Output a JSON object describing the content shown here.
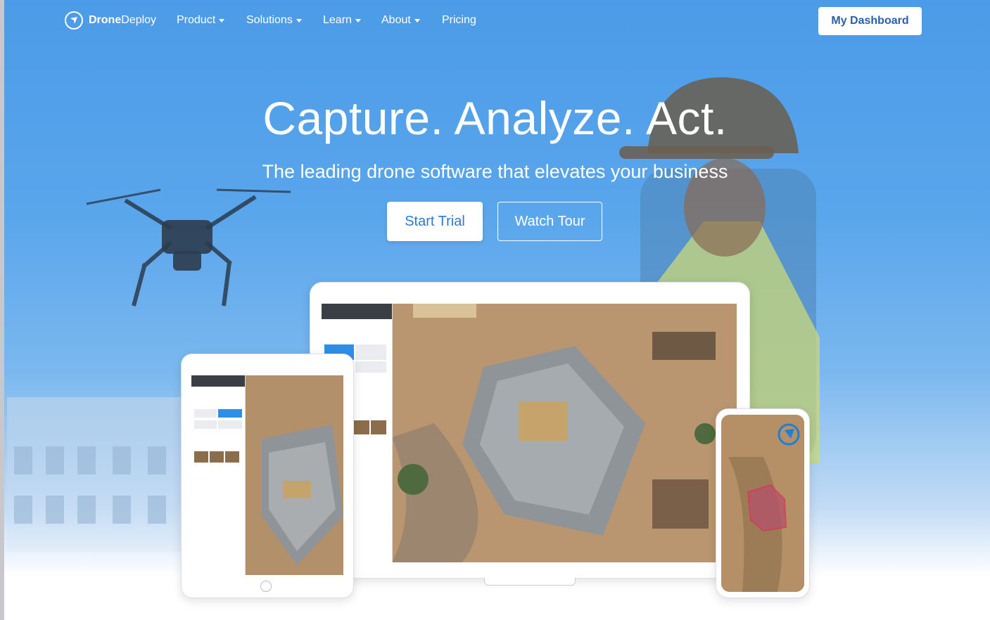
{
  "nav": {
    "brand_bold": "Drone",
    "brand_light": "Deploy",
    "items": [
      {
        "label": "Product",
        "dropdown": true
      },
      {
        "label": "Solutions",
        "dropdown": true
      },
      {
        "label": "Learn",
        "dropdown": true
      },
      {
        "label": "About",
        "dropdown": true
      },
      {
        "label": "Pricing",
        "dropdown": false
      }
    ],
    "dashboard_label": "My Dashboard"
  },
  "hero": {
    "headline": "Capture. Analyze. Act.",
    "subhead": "The leading drone software that elevates your business",
    "start_trial_label": "Start Trial",
    "watch_tour_label": "Watch Tour"
  },
  "colors": {
    "sky_blue": "#4b9be8",
    "button_text_blue": "#2b7bd4",
    "dashboard_text": "#2b5fa6",
    "white": "#ffffff"
  },
  "icons": [
    "dronedeploy-logo-icon",
    "chevron-down-icon",
    "drone-illustration",
    "construction-worker-illustration"
  ]
}
